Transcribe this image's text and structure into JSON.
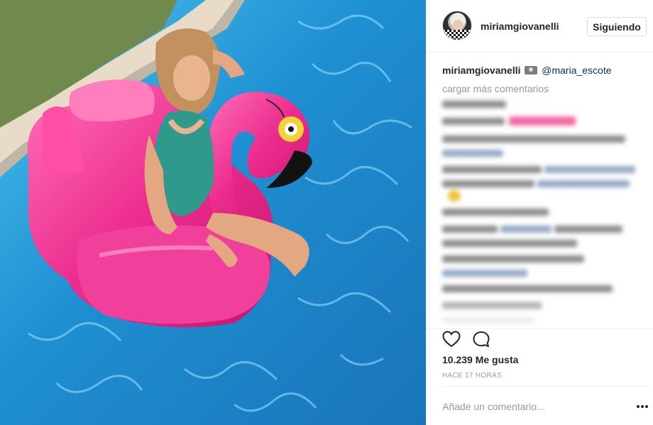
{
  "post": {
    "author": {
      "username": "miriamgiovanelli",
      "follow_label": "Siguiendo"
    },
    "caption": {
      "username": "miriamgiovanelli",
      "emoji": "camera-with-flash",
      "mention": "@maria_escote"
    },
    "load_more_comments": "cargar más comentarios",
    "stats": {
      "likes": "10.239 Me gusta",
      "time_ago": "HACE 17 HORAS"
    },
    "comment_input": {
      "placeholder": "Añade un comentario..."
    },
    "icons": [
      "heart-icon",
      "comment-icon",
      "more-options-icon",
      "camera-icon"
    ],
    "colors": {
      "mention": "#003569",
      "secondary_text": "#999999",
      "pool_blue": "#1f8fd0",
      "float_pink": "#ea2a8a"
    }
  }
}
